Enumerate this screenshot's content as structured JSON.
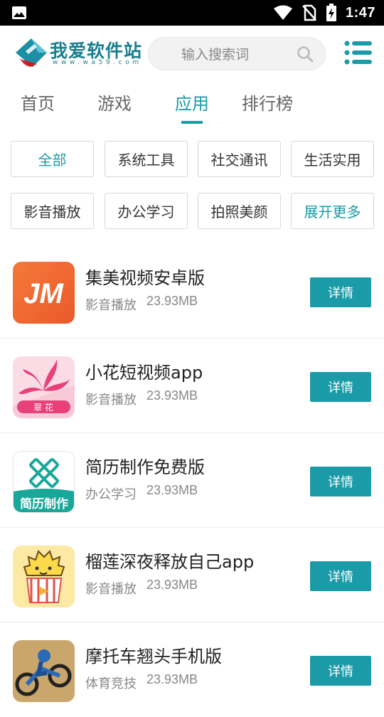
{
  "status_bar": {
    "time": "1:47",
    "icons": [
      "picture-icon",
      "wifi-icon",
      "no-sim-icon",
      "battery-charging-icon"
    ]
  },
  "header": {
    "logo_text": "我爱软件站",
    "logo_url": "www.wa59.com",
    "search_placeholder": "输入搜索词",
    "icons": [
      "search-icon",
      "menu-list-icon"
    ]
  },
  "tabs": [
    {
      "label": "首页",
      "active": false
    },
    {
      "label": "游戏",
      "active": false
    },
    {
      "label": "应用",
      "active": true
    },
    {
      "label": "排行榜",
      "active": false
    }
  ],
  "filters": [
    {
      "label": "全部",
      "accent": true
    },
    {
      "label": "系统工具",
      "accent": false
    },
    {
      "label": "社交通讯",
      "accent": false
    },
    {
      "label": "生活实用",
      "accent": false
    },
    {
      "label": "影音播放",
      "accent": false
    },
    {
      "label": "办公学习",
      "accent": false
    },
    {
      "label": "拍照美颜",
      "accent": false
    },
    {
      "label": "展开更多",
      "accent": true
    }
  ],
  "apps": [
    {
      "name": "集美视频安卓版",
      "category": "影音播放",
      "size": "23.93MB",
      "button": "详情",
      "icon_text": "JM"
    },
    {
      "name": "小花短视频app",
      "category": "影音播放",
      "size": "23.93MB",
      "button": "详情",
      "icon_text": "翠 花"
    },
    {
      "name": "简历制作免费版",
      "category": "办公学习",
      "size": "23.93MB",
      "button": "详情",
      "icon_text": "简历制作"
    },
    {
      "name": "榴莲深夜释放自己app",
      "category": "影音播放",
      "size": "23.93MB",
      "button": "详情",
      "icon_text": ""
    },
    {
      "name": "摩托车翘头手机版",
      "category": "体育竞技",
      "size": "23.93MB",
      "button": "详情",
      "icon_text": ""
    }
  ],
  "colors": {
    "accent": "#1a9ba7",
    "status_bar": "#000000"
  }
}
